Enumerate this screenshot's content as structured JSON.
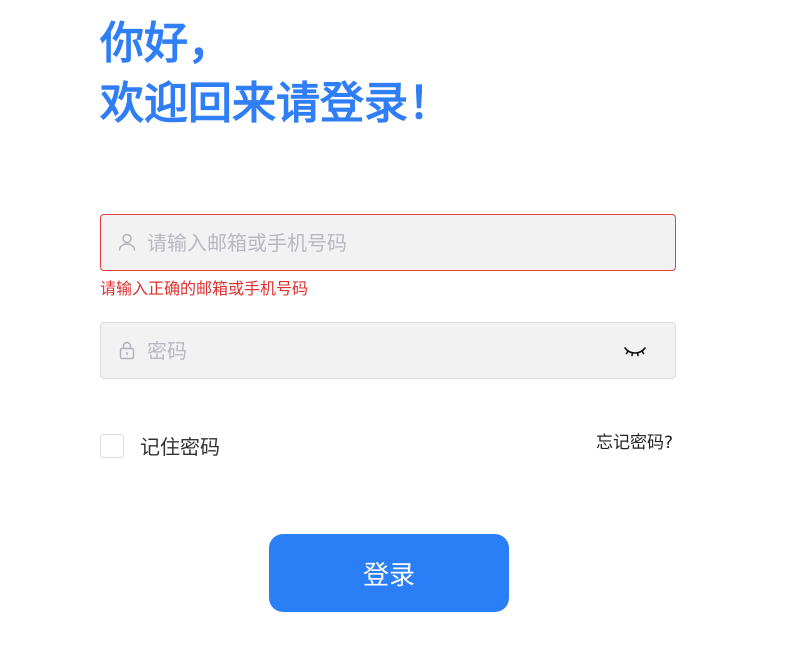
{
  "greeting": {
    "line1": "你好，",
    "line2": "欢迎回来请登录！"
  },
  "account": {
    "placeholder": "请输入邮箱或手机号码",
    "value": "",
    "error": "请输入正确的邮箱或手机号码"
  },
  "password": {
    "placeholder": "密码",
    "value": ""
  },
  "remember": {
    "label": "记住密码",
    "checked": false
  },
  "forgot_label": "忘记密码?",
  "login_label": "登录",
  "colors": {
    "accent": "#2f7ef5",
    "button": "#2a7ff7",
    "error": "#e03030",
    "field_bg": "#f2f2f2"
  },
  "icons": [
    "user-icon",
    "lock-icon",
    "eye-closed-icon"
  ]
}
